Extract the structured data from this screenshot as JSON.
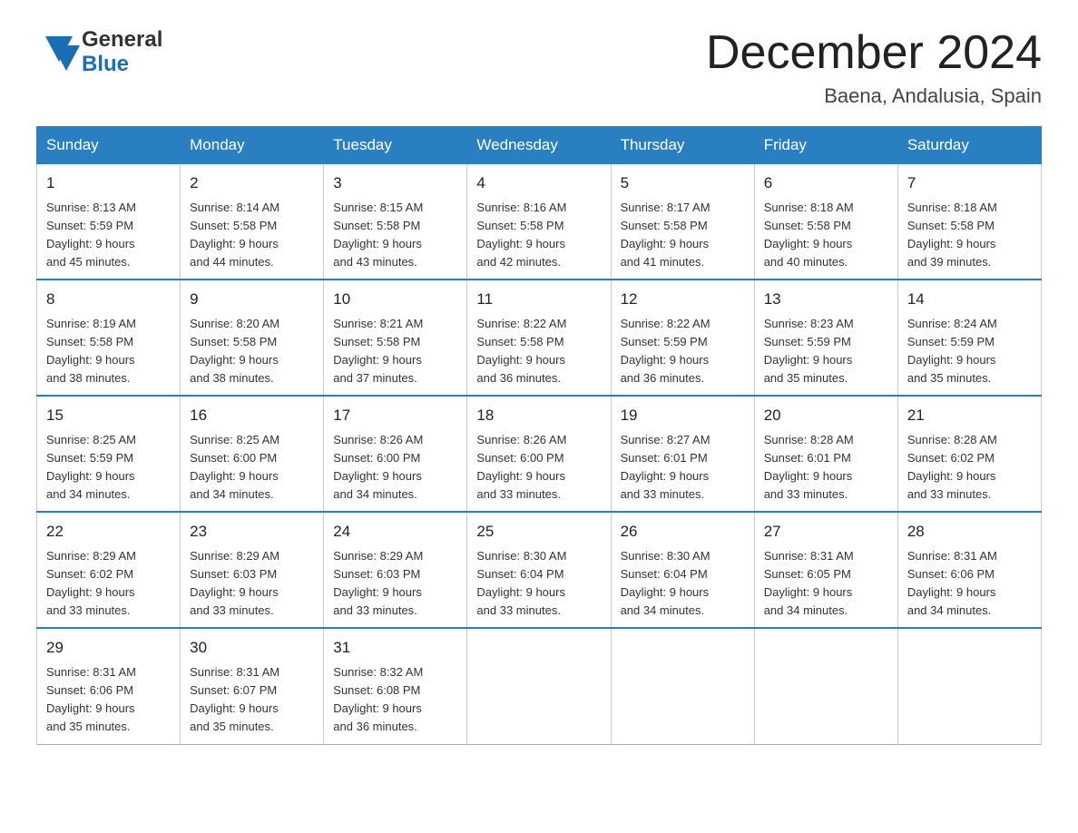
{
  "header": {
    "logo_line1": "General",
    "logo_line2": "Blue",
    "month_title": "December 2024",
    "location": "Baena, Andalusia, Spain"
  },
  "days_of_week": [
    "Sunday",
    "Monday",
    "Tuesday",
    "Wednesday",
    "Thursday",
    "Friday",
    "Saturday"
  ],
  "weeks": [
    [
      {
        "day": "1",
        "sunrise": "8:13 AM",
        "sunset": "5:59 PM",
        "daylight_hours": "9 hours",
        "daylight_minutes": "45 minutes"
      },
      {
        "day": "2",
        "sunrise": "8:14 AM",
        "sunset": "5:58 PM",
        "daylight_hours": "9 hours",
        "daylight_minutes": "44 minutes"
      },
      {
        "day": "3",
        "sunrise": "8:15 AM",
        "sunset": "5:58 PM",
        "daylight_hours": "9 hours",
        "daylight_minutes": "43 minutes"
      },
      {
        "day": "4",
        "sunrise": "8:16 AM",
        "sunset": "5:58 PM",
        "daylight_hours": "9 hours",
        "daylight_minutes": "42 minutes"
      },
      {
        "day": "5",
        "sunrise": "8:17 AM",
        "sunset": "5:58 PM",
        "daylight_hours": "9 hours",
        "daylight_minutes": "41 minutes"
      },
      {
        "day": "6",
        "sunrise": "8:18 AM",
        "sunset": "5:58 PM",
        "daylight_hours": "9 hours",
        "daylight_minutes": "40 minutes"
      },
      {
        "day": "7",
        "sunrise": "8:18 AM",
        "sunset": "5:58 PM",
        "daylight_hours": "9 hours",
        "daylight_minutes": "39 minutes"
      }
    ],
    [
      {
        "day": "8",
        "sunrise": "8:19 AM",
        "sunset": "5:58 PM",
        "daylight_hours": "9 hours",
        "daylight_minutes": "38 minutes"
      },
      {
        "day": "9",
        "sunrise": "8:20 AM",
        "sunset": "5:58 PM",
        "daylight_hours": "9 hours",
        "daylight_minutes": "38 minutes"
      },
      {
        "day": "10",
        "sunrise": "8:21 AM",
        "sunset": "5:58 PM",
        "daylight_hours": "9 hours",
        "daylight_minutes": "37 minutes"
      },
      {
        "day": "11",
        "sunrise": "8:22 AM",
        "sunset": "5:58 PM",
        "daylight_hours": "9 hours",
        "daylight_minutes": "36 minutes"
      },
      {
        "day": "12",
        "sunrise": "8:22 AM",
        "sunset": "5:59 PM",
        "daylight_hours": "9 hours",
        "daylight_minutes": "36 minutes"
      },
      {
        "day": "13",
        "sunrise": "8:23 AM",
        "sunset": "5:59 PM",
        "daylight_hours": "9 hours",
        "daylight_minutes": "35 minutes"
      },
      {
        "day": "14",
        "sunrise": "8:24 AM",
        "sunset": "5:59 PM",
        "daylight_hours": "9 hours",
        "daylight_minutes": "35 minutes"
      }
    ],
    [
      {
        "day": "15",
        "sunrise": "8:25 AM",
        "sunset": "5:59 PM",
        "daylight_hours": "9 hours",
        "daylight_minutes": "34 minutes"
      },
      {
        "day": "16",
        "sunrise": "8:25 AM",
        "sunset": "6:00 PM",
        "daylight_hours": "9 hours",
        "daylight_minutes": "34 minutes"
      },
      {
        "day": "17",
        "sunrise": "8:26 AM",
        "sunset": "6:00 PM",
        "daylight_hours": "9 hours",
        "daylight_minutes": "34 minutes"
      },
      {
        "day": "18",
        "sunrise": "8:26 AM",
        "sunset": "6:00 PM",
        "daylight_hours": "9 hours",
        "daylight_minutes": "33 minutes"
      },
      {
        "day": "19",
        "sunrise": "8:27 AM",
        "sunset": "6:01 PM",
        "daylight_hours": "9 hours",
        "daylight_minutes": "33 minutes"
      },
      {
        "day": "20",
        "sunrise": "8:28 AM",
        "sunset": "6:01 PM",
        "daylight_hours": "9 hours",
        "daylight_minutes": "33 minutes"
      },
      {
        "day": "21",
        "sunrise": "8:28 AM",
        "sunset": "6:02 PM",
        "daylight_hours": "9 hours",
        "daylight_minutes": "33 minutes"
      }
    ],
    [
      {
        "day": "22",
        "sunrise": "8:29 AM",
        "sunset": "6:02 PM",
        "daylight_hours": "9 hours",
        "daylight_minutes": "33 minutes"
      },
      {
        "day": "23",
        "sunrise": "8:29 AM",
        "sunset": "6:03 PM",
        "daylight_hours": "9 hours",
        "daylight_minutes": "33 minutes"
      },
      {
        "day": "24",
        "sunrise": "8:29 AM",
        "sunset": "6:03 PM",
        "daylight_hours": "9 hours",
        "daylight_minutes": "33 minutes"
      },
      {
        "day": "25",
        "sunrise": "8:30 AM",
        "sunset": "6:04 PM",
        "daylight_hours": "9 hours",
        "daylight_minutes": "33 minutes"
      },
      {
        "day": "26",
        "sunrise": "8:30 AM",
        "sunset": "6:04 PM",
        "daylight_hours": "9 hours",
        "daylight_minutes": "34 minutes"
      },
      {
        "day": "27",
        "sunrise": "8:31 AM",
        "sunset": "6:05 PM",
        "daylight_hours": "9 hours",
        "daylight_minutes": "34 minutes"
      },
      {
        "day": "28",
        "sunrise": "8:31 AM",
        "sunset": "6:06 PM",
        "daylight_hours": "9 hours",
        "daylight_minutes": "34 minutes"
      }
    ],
    [
      {
        "day": "29",
        "sunrise": "8:31 AM",
        "sunset": "6:06 PM",
        "daylight_hours": "9 hours",
        "daylight_minutes": "35 minutes"
      },
      {
        "day": "30",
        "sunrise": "8:31 AM",
        "sunset": "6:07 PM",
        "daylight_hours": "9 hours",
        "daylight_minutes": "35 minutes"
      },
      {
        "day": "31",
        "sunrise": "8:32 AM",
        "sunset": "6:08 PM",
        "daylight_hours": "9 hours",
        "daylight_minutes": "36 minutes"
      },
      null,
      null,
      null,
      null
    ]
  ]
}
